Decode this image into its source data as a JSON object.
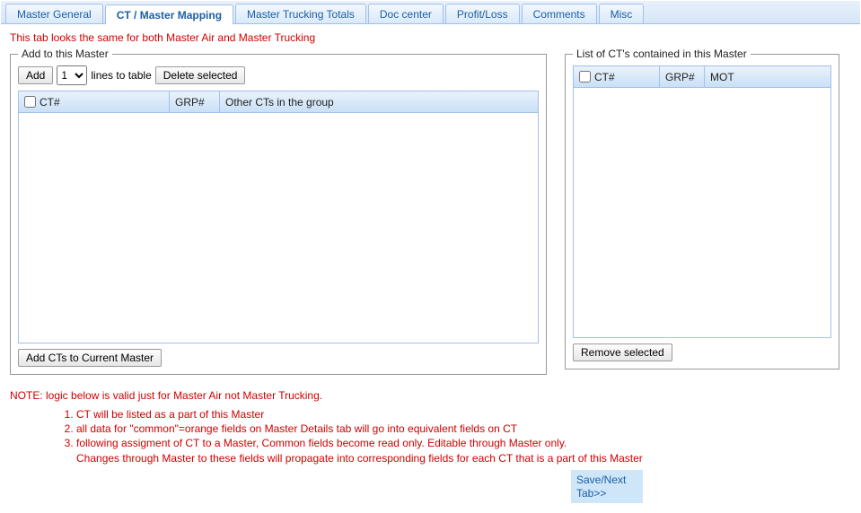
{
  "tabs": [
    {
      "label": "Master General"
    },
    {
      "label": "CT / Master Mapping"
    },
    {
      "label": "Master Trucking Totals"
    },
    {
      "label": "Doc center"
    },
    {
      "label": "Profit/Loss"
    },
    {
      "label": "Comments"
    },
    {
      "label": "Misc"
    }
  ],
  "top_note": "This tab looks the same for both Master Air and Master Trucking",
  "left_group": {
    "legend": "Add to this Master",
    "add_button": "Add",
    "lines_select_value": "1",
    "lines_label": "lines to table",
    "delete_button": "Delete selected",
    "columns": {
      "ct": "CT#",
      "grp": "GRP#",
      "other": "Other CTs in the group"
    },
    "footer_button": "Add CTs to Current Master"
  },
  "right_group": {
    "legend": "List of CT's contained in this Master",
    "columns": {
      "ct": "CT#",
      "grp": "GRP#",
      "mot": "MOT"
    },
    "footer_button": "Remove selected"
  },
  "bottom_note": {
    "heading": "NOTE: logic below is valid just for Master Air not Master Trucking.",
    "items": [
      "CT will be listed as a part of this Master",
      "all data for \"common\"=orange fields on Master Details tab will go into equivalent fields on CT",
      "following assigment of CT to a Master, Common fields become read only. Editable through Master only."
    ],
    "extra": "Changes through Master to these fields will propagate into corresponding fields for each CT that is a part of this Master"
  },
  "save_next": "Save/Next Tab>>"
}
